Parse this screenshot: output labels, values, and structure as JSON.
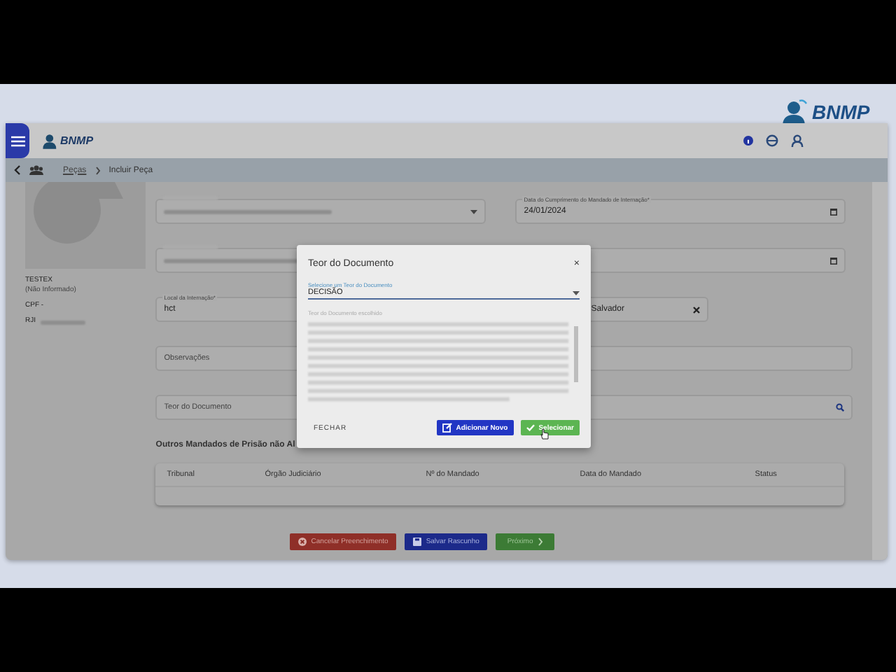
{
  "corner_logo": {
    "name": "BNMP"
  },
  "header": {
    "logo": "BNMP"
  },
  "breadcrumb": [
    {
      "label": "Peças",
      "kind": "link"
    },
    {
      "label": "Incluir Peça",
      "kind": "current"
    }
  ],
  "person": {
    "name": "TESTEX",
    "note": "(Não Informado)",
    "cpf": "CPF -",
    "rji": "RJI"
  },
  "form_rows": [
    {
      "fields": [
        {
          "redacted": true,
          "kind": "dropdown"
        },
        {
          "label": "Data do Cumprimento do Mandado de Internação*",
          "value": "24/01/2024",
          "kind": "date",
          "redacted": false
        }
      ]
    },
    {
      "fields": [
        {
          "redacted": true,
          "kind": "text"
        },
        {
          "redacted": false,
          "kind": "date"
        }
      ]
    },
    {
      "fields": [
        {
          "label": "Local da Internação*",
          "value": "hct",
          "redacted": false,
          "kind": "text"
        },
        {
          "value": "Salvador",
          "kind": "clearable",
          "redacted": false
        }
      ]
    },
    {
      "fields": [
        {
          "placeholder": "Observações",
          "redacted": false,
          "kind": "text"
        }
      ]
    },
    {
      "fields": [
        {
          "placeholder": "Teor do Documento",
          "redacted": false,
          "kind": "search"
        }
      ]
    }
  ],
  "table": {
    "title": "Outros Mandados de Prisão não Al",
    "columns": [
      "Tribunal",
      "Órgão Judiciário",
      "Nº do Mandado",
      "Data do Mandado",
      "Status"
    ]
  },
  "actions": [
    {
      "label": "Cancelar Preenchimento",
      "kind": "cancel"
    },
    {
      "label": "Salvar Rascunho",
      "kind": "save"
    },
    {
      "label": "Próximo",
      "kind": "next"
    }
  ],
  "dialog": {
    "title": "Teor do Documento",
    "close": "×",
    "select_label": "Selecione um Teor do Documento",
    "select_value": "DECISÃO",
    "text_label": "Teor do Documento escolhido",
    "buttons": [
      {
        "label": "FECHAR",
        "kind": "text"
      },
      {
        "label": "Adicionar Novo",
        "kind": "add"
      },
      {
        "label": "Selecionar",
        "kind": "select"
      }
    ]
  }
}
